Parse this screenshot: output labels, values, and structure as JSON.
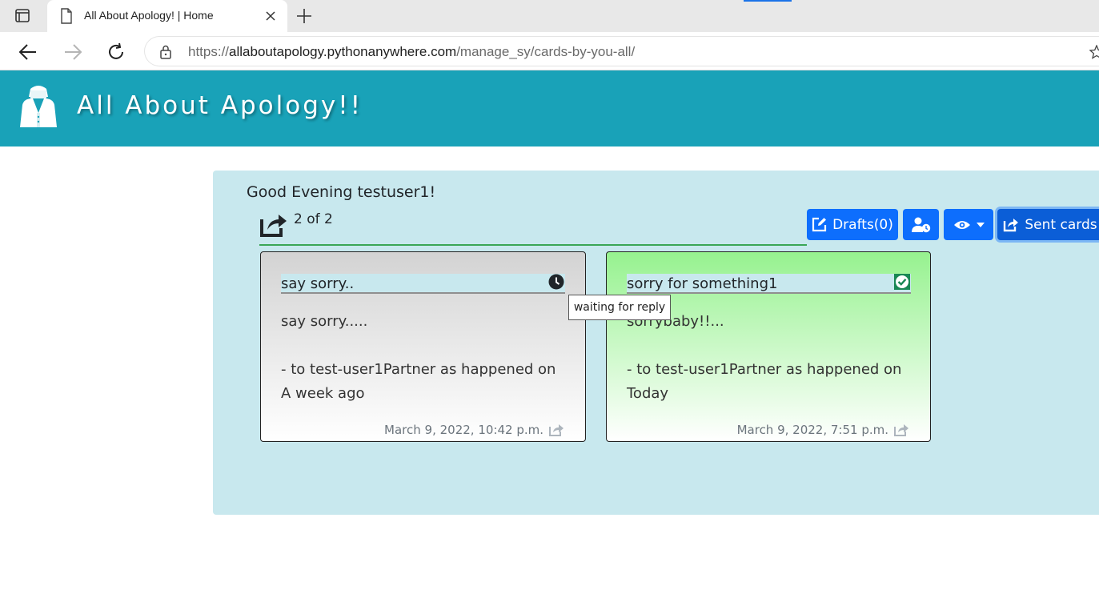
{
  "browser": {
    "tab_title": "All About Apology! | Home",
    "url_scheme": "https://",
    "url_host": "allaboutapology.pythonanywhere.com",
    "url_path": "/manage_sy/cards-by-you-all/"
  },
  "site": {
    "brand": "All About Apology!!",
    "header_color": "#19a2b8"
  },
  "page": {
    "greeting": "Good Evening testuser1!",
    "count": "2 of 2",
    "buttons": {
      "drafts": "Drafts(0)",
      "sent": "Sent cards"
    }
  },
  "cards": [
    {
      "title": "say sorry..",
      "message": "say sorry.....",
      "recipient_line": "- to test-user1Partner as happened on",
      "when": "A week ago",
      "timestamp": "March 9, 2022, 10:42 p.m.",
      "status_icon": "clock-icon",
      "status_tooltip": "waiting for reply"
    },
    {
      "title": "sorry for something1",
      "message": "sorrybaby!!...",
      "recipient_line": "- to test-user1Partner as happened on",
      "when": "Today",
      "timestamp": "March 9, 2022, 7:51 p.m.",
      "status_icon": "check-square-icon"
    }
  ]
}
